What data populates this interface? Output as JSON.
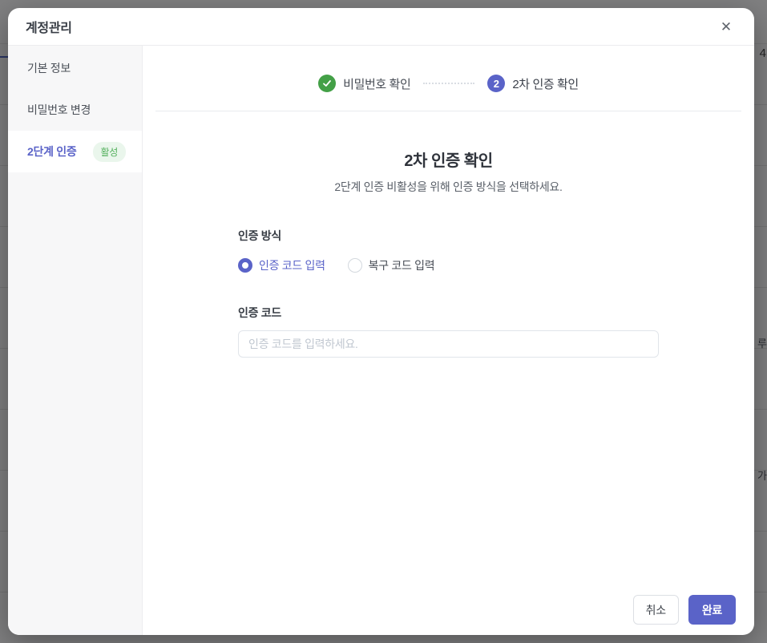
{
  "modal": {
    "title": "계정관리",
    "close_glyph": "✕"
  },
  "sidebar": {
    "items": [
      {
        "label": "기본 정보",
        "active": false
      },
      {
        "label": "비밀번호 변경",
        "active": false
      },
      {
        "label": "2단계 인증",
        "active": true,
        "badge": "활성"
      }
    ]
  },
  "stepper": {
    "steps": [
      {
        "label": "비밀번호 확인",
        "state": "done",
        "icon": "check"
      },
      {
        "label": "2차 인증 확인",
        "state": "current",
        "number": "2"
      }
    ]
  },
  "content": {
    "title": "2차 인증 확인",
    "subtitle": "2단계 인증 비활성을 위해 인증 방식을 선택하세요.",
    "method_label": "인증 방식",
    "radios": [
      {
        "label": "인증 코드 입력",
        "selected": true
      },
      {
        "label": "복구 코드 입력",
        "selected": false
      }
    ],
    "code_label": "인증 코드",
    "code_placeholder": "인증 코드를 입력하세요."
  },
  "footer": {
    "cancel_label": "취소",
    "submit_label": "완료"
  },
  "background": {
    "visible_fragment": "4"
  },
  "colors": {
    "accent": "#5a63c8",
    "success": "#43a047",
    "badge_bg": "#eaf6ec",
    "badge_text": "#53b05c"
  }
}
